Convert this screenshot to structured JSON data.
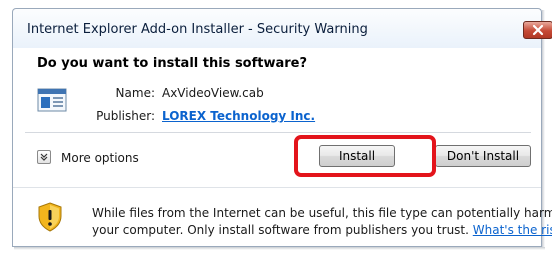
{
  "window": {
    "title": "Internet Explorer Add-on Installer - Security Warning",
    "close_icon": "close-x-icon"
  },
  "dialog": {
    "question": "Do you want to install this software?",
    "file_icon": "cab-file-icon",
    "name_label": "Name:",
    "name_value": "AxVideoView.cab",
    "publisher_label": "Publisher:",
    "publisher_value": "LOREX Technology Inc.",
    "more_options_label": "More options",
    "install_label": "Install",
    "dont_install_label": "Don't Install",
    "warning_icon": "shield-warning-icon",
    "warning_line1": "While files from the Internet can be useful, this file type can potentially harm",
    "warning_line2": "your computer. Only install software from publishers you trust.",
    "risk_link": "What's the risk?"
  },
  "colors": {
    "highlight": "#e3141b",
    "link": "#0b63ce",
    "close_button": "#c64a36"
  }
}
